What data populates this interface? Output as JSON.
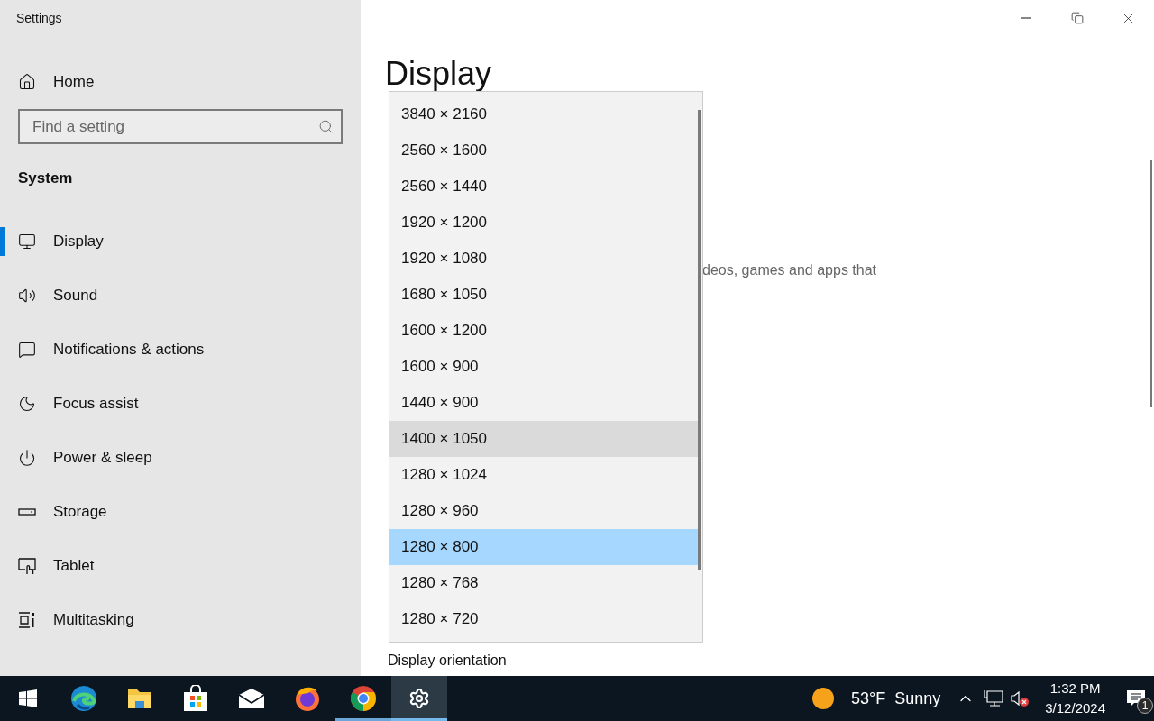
{
  "window": {
    "title": "Settings"
  },
  "sidebar": {
    "home": "Home",
    "search": {
      "placeholder": "Find a setting"
    },
    "section": "System",
    "items": [
      {
        "label": "Display",
        "kind": "display",
        "selected": true
      },
      {
        "label": "Sound",
        "kind": "sound",
        "selected": false
      },
      {
        "label": "Notifications & actions",
        "kind": "notifications",
        "selected": false
      },
      {
        "label": "Focus assist",
        "kind": "focus",
        "selected": false
      },
      {
        "label": "Power & sleep",
        "kind": "power",
        "selected": false
      },
      {
        "label": "Storage",
        "kind": "storage",
        "selected": false
      },
      {
        "label": "Tablet",
        "kind": "tablet",
        "selected": false
      },
      {
        "label": "Multitasking",
        "kind": "multitasking",
        "selected": false
      }
    ]
  },
  "page": {
    "title": "Display",
    "description": "deos, games and apps that",
    "orientation_label": "Display orientation"
  },
  "resolution_dropdown": {
    "options": [
      {
        "label": "3840 × 2160",
        "hovered": false,
        "selected": false
      },
      {
        "label": "2560 × 1600",
        "hovered": false,
        "selected": false
      },
      {
        "label": "2560 × 1440",
        "hovered": false,
        "selected": false
      },
      {
        "label": "1920 × 1200",
        "hovered": false,
        "selected": false
      },
      {
        "label": "1920 × 1080",
        "hovered": false,
        "selected": false
      },
      {
        "label": "1680 × 1050",
        "hovered": false,
        "selected": false
      },
      {
        "label": "1600 × 1200",
        "hovered": false,
        "selected": false
      },
      {
        "label": "1600 × 900",
        "hovered": false,
        "selected": false
      },
      {
        "label": "1440 × 900",
        "hovered": false,
        "selected": false
      },
      {
        "label": "1400 × 1050",
        "hovered": true,
        "selected": false
      },
      {
        "label": "1280 × 1024",
        "hovered": false,
        "selected": false
      },
      {
        "label": "1280 × 960",
        "hovered": false,
        "selected": false
      },
      {
        "label": "1280 × 800",
        "hovered": false,
        "selected": true
      },
      {
        "label": "1280 × 768",
        "hovered": false,
        "selected": false
      },
      {
        "label": "1280 × 720",
        "hovered": false,
        "selected": false
      }
    ]
  },
  "taskbar": {
    "apps": [
      {
        "kind": "start",
        "running": false,
        "active": false
      },
      {
        "kind": "edge",
        "running": false,
        "active": false
      },
      {
        "kind": "folder",
        "running": false,
        "active": false
      },
      {
        "kind": "store",
        "running": false,
        "active": false
      },
      {
        "kind": "mail",
        "running": false,
        "active": false
      },
      {
        "kind": "firefox",
        "running": false,
        "active": false
      },
      {
        "kind": "chrome",
        "running": true,
        "active": false
      },
      {
        "kind": "settings",
        "running": true,
        "active": true
      }
    ],
    "weather": {
      "temperature": "53°F",
      "condition": "Sunny"
    },
    "clock": {
      "time": "1:32 PM",
      "date": "3/12/2024"
    },
    "notifications": {
      "count": "1"
    }
  }
}
